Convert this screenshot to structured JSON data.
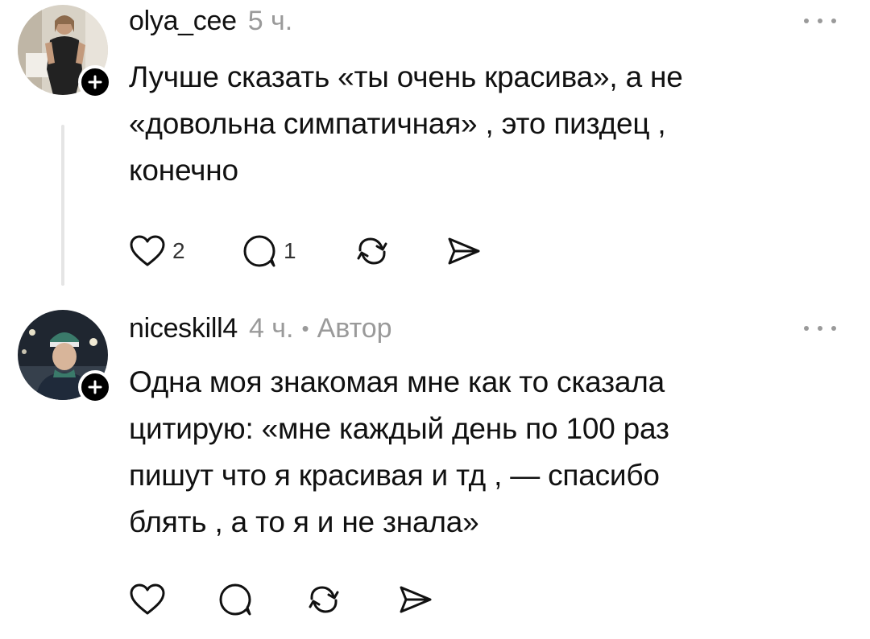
{
  "comments": [
    {
      "username": "olya_cee",
      "time": "5 ч.",
      "author_tag": "",
      "text_lines": [
        "Лучше сказать «ты очень красива», а не",
        "«довольна симпатичная» , это пиздец ,",
        "конечно"
      ],
      "likes": "2",
      "replies": "1",
      "avatar": "avatar-photo"
    },
    {
      "username": "niceskill4",
      "time": "4 ч.",
      "separator": "•",
      "author_tag": "Автор",
      "text_lines": [
        "Одна моя знакомая мне как то сказала",
        "цитирую: «мне каждый день по 100 раз",
        "пишут что я красивая и тд , — спасибо",
        "блять , а то я и не знала»"
      ],
      "likes": "",
      "replies": "",
      "avatar": "avatar-photo"
    }
  ],
  "icons": {
    "more": "more-horizontal-icon",
    "like": "heart-icon",
    "reply": "comment-icon",
    "repost": "repost-icon",
    "share": "send-icon",
    "follow": "plus-icon"
  }
}
